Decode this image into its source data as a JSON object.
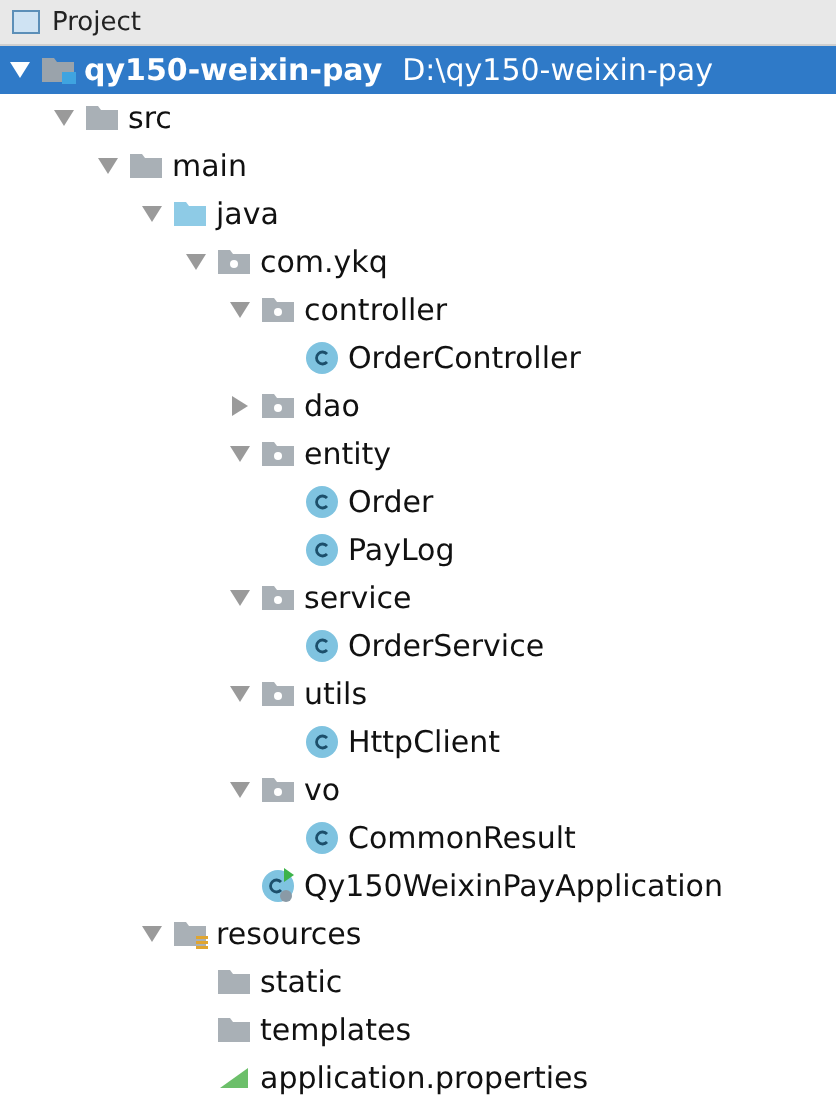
{
  "panel": {
    "title": "Project"
  },
  "tree": [
    {
      "label": "qy150-weixin-pay",
      "path": "D:\\qy150-weixin-pay",
      "kind": "module",
      "selected": true,
      "expanded": true,
      "children": [
        {
          "label": "src",
          "kind": "folder",
          "selected": false,
          "expanded": true,
          "children": [
            {
              "label": "main",
              "kind": "folder",
              "selected": false,
              "expanded": true,
              "children": [
                {
                  "label": "java",
                  "kind": "source",
                  "selected": false,
                  "expanded": true,
                  "children": [
                    {
                      "label": "com.ykq",
                      "kind": "package",
                      "selected": false,
                      "expanded": true,
                      "children": [
                        {
                          "label": "controller",
                          "kind": "package",
                          "selected": false,
                          "expanded": true,
                          "children": [
                            {
                              "label": "OrderController",
                              "kind": "class",
                              "selected": false
                            }
                          ]
                        },
                        {
                          "label": "dao",
                          "kind": "package",
                          "selected": false,
                          "expanded": false
                        },
                        {
                          "label": "entity",
                          "kind": "package",
                          "selected": false,
                          "expanded": true,
                          "children": [
                            {
                              "label": "Order",
                              "kind": "class",
                              "selected": false
                            },
                            {
                              "label": "PayLog",
                              "kind": "class",
                              "selected": false
                            }
                          ]
                        },
                        {
                          "label": "service",
                          "kind": "package",
                          "selected": false,
                          "expanded": true,
                          "children": [
                            {
                              "label": "OrderService",
                              "kind": "class",
                              "selected": false
                            }
                          ]
                        },
                        {
                          "label": "utils",
                          "kind": "package",
                          "selected": false,
                          "expanded": true,
                          "children": [
                            {
                              "label": "HttpClient",
                              "kind": "class",
                              "selected": false
                            }
                          ]
                        },
                        {
                          "label": "vo",
                          "kind": "package",
                          "selected": false,
                          "expanded": true,
                          "children": [
                            {
                              "label": "CommonResult",
                              "kind": "class",
                              "selected": false
                            }
                          ]
                        },
                        {
                          "label": "Qy150WeixinPayApplication",
                          "kind": "app",
                          "selected": false
                        }
                      ]
                    }
                  ]
                },
                {
                  "label": "resources",
                  "kind": "resources",
                  "selected": false,
                  "expanded": true,
                  "children": [
                    {
                      "label": "static",
                      "kind": "folder",
                      "selected": false
                    },
                    {
                      "label": "templates",
                      "kind": "folder",
                      "selected": false
                    },
                    {
                      "label": "application.properties",
                      "kind": "properties",
                      "selected": false
                    }
                  ]
                }
              ]
            }
          ]
        }
      ]
    }
  ]
}
